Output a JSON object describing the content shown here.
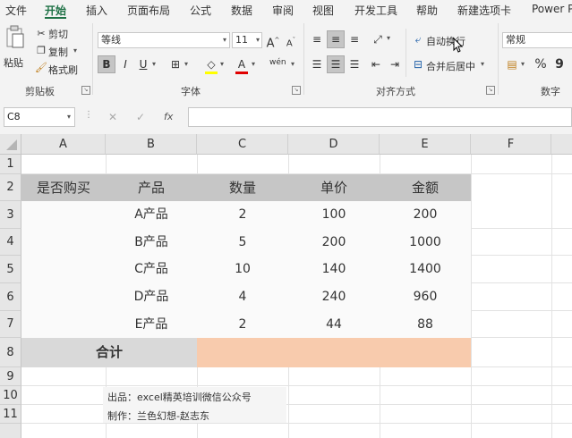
{
  "tabs": [
    "文件",
    "开始",
    "插入",
    "页面布局",
    "公式",
    "数据",
    "审阅",
    "视图",
    "开发工具",
    "帮助",
    "新建选项卡",
    "Power P"
  ],
  "clipboard": {
    "paste": "粘贴",
    "cut": "剪切",
    "copy": "复制",
    "format_painter": "格式刷",
    "group": "剪贴板"
  },
  "font": {
    "name": "等线",
    "size": "11",
    "grow": "A",
    "shrink": "A",
    "bold": "B",
    "italic": "I",
    "underline": "U",
    "fill_icon": "◇",
    "color_icon": "A",
    "phonetic": "wén",
    "group": "字体"
  },
  "alignment": {
    "wrap": "自动换行",
    "merge": "合并后居中",
    "group": "对齐方式"
  },
  "number": {
    "format": "常规",
    "percent": "%",
    "comma": "9",
    "group": "数字"
  },
  "formula_bar": {
    "name_box": "C8",
    "cancel": "✕",
    "enter": "✓",
    "fx": "fx",
    "value": ""
  },
  "columns": [
    "A",
    "B",
    "C",
    "D",
    "E",
    "F"
  ],
  "rows": [
    "1",
    "2",
    "3",
    "4",
    "5",
    "6",
    "7",
    "8",
    "9",
    "10",
    "11"
  ],
  "table": {
    "headers": [
      "是否购买",
      "产品",
      "数量",
      "单价",
      "金额"
    ],
    "data": [
      [
        "",
        "A产品",
        "2",
        "100",
        "200"
      ],
      [
        "",
        "B产品",
        "5",
        "200",
        "1000"
      ],
      [
        "",
        "C产品",
        "10",
        "140",
        "1400"
      ],
      [
        "",
        "D产品",
        "4",
        "240",
        "960"
      ],
      [
        "",
        "E产品",
        "2",
        "44",
        "88"
      ]
    ],
    "total_label": "合计"
  },
  "footer": {
    "line1": "出品：excel精英培训微信公众号",
    "line2": "制作：兰色幻想-赵志东"
  },
  "colors": {
    "header_fill": "#c6c6c6",
    "total_label_fill": "#d9d9d9",
    "total_value_fill": "#f8cbad",
    "accent": "#1e7145"
  }
}
